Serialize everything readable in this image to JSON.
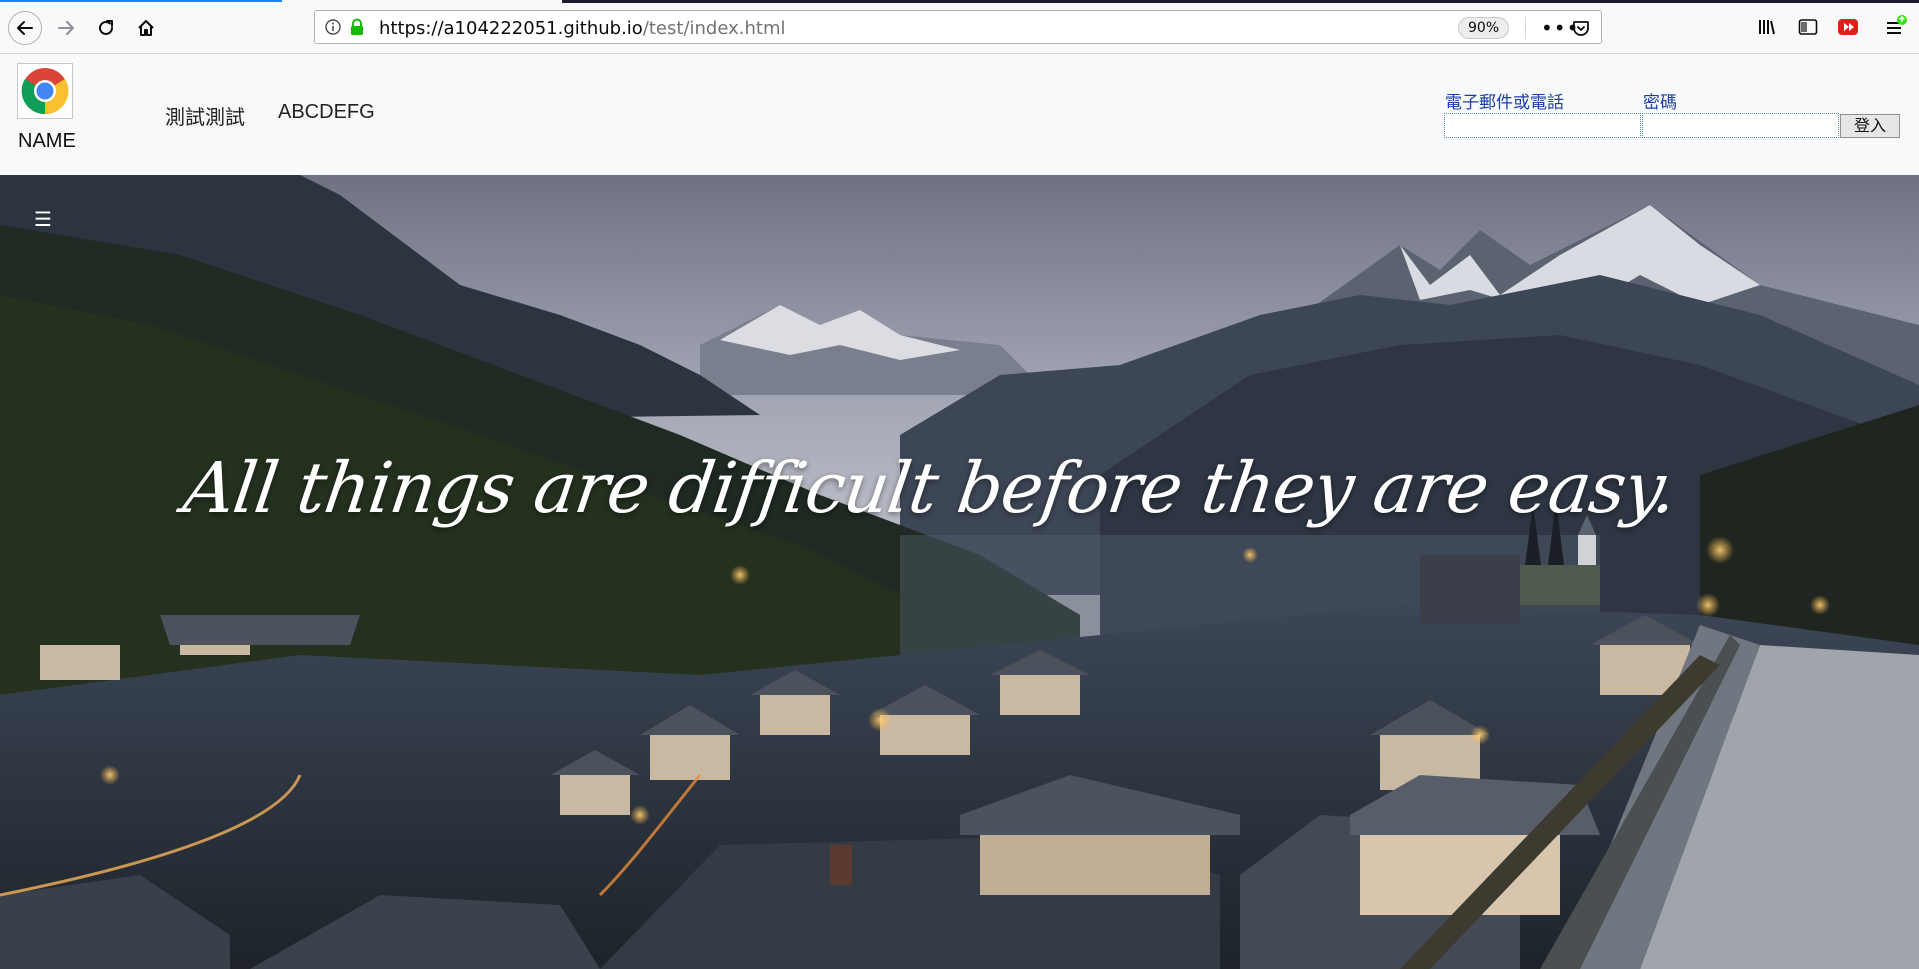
{
  "browser": {
    "url_host": "https://a104222051.github.io",
    "url_path": "/test/index.html",
    "zoom": "90%",
    "icons": [
      "back-icon",
      "forward-icon",
      "reload-icon",
      "home-icon",
      "info-icon",
      "lock-icon",
      "more-icon",
      "pocket-icon",
      "library-icon",
      "sidebar-icon",
      "extension-icon",
      "menu-icon"
    ]
  },
  "header": {
    "brand": "NAME",
    "nav": [
      {
        "label": "測試測試"
      },
      {
        "label": "ABCDEFG"
      }
    ],
    "login": {
      "email_label": "電子郵件或電話",
      "password_label": "密碼",
      "email_value": "",
      "password_value": "",
      "submit_label": "登入"
    }
  },
  "hero": {
    "menu_icon": "☰",
    "quote": "All things are difficult before they are easy."
  },
  "colors": {
    "header_bg": "#f8f9fa",
    "label_blue": "#1a3fa8",
    "url_green": "#12bc00"
  }
}
